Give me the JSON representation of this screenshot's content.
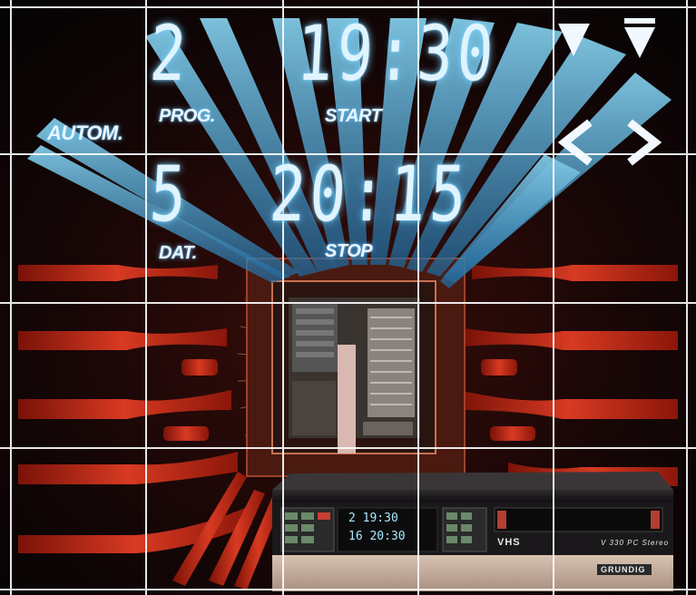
{
  "display": {
    "row1": {
      "program": "2",
      "time": "19:30"
    },
    "row2": {
      "date": "5",
      "time": "20:15"
    }
  },
  "labels": {
    "autom": "AUTOM.",
    "prog": "PROG.",
    "start": "START",
    "dat": "DAT.",
    "stop": "STOP"
  },
  "vcr": {
    "display_row1": "2  19:30",
    "display_row2": "16  20:30",
    "format_logo": "VHS",
    "model": "V 330 PC Stereo",
    "brand": "GRUNDIG"
  },
  "colors": {
    "beam": "#5ec8f2",
    "circuit_red": "#c8281c",
    "background": "#0a0608",
    "grid": "#ffffff"
  }
}
